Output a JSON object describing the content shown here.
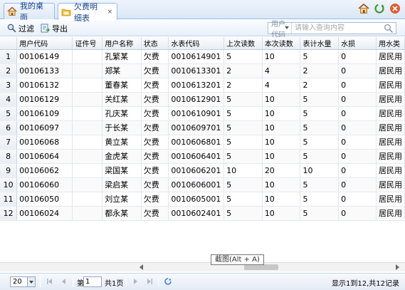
{
  "tabs": [
    {
      "label": "我的桌面",
      "icon": "home-icon",
      "active": false,
      "closable": false
    },
    {
      "label": "欠费明细表",
      "icon": "folder-icon",
      "active": true,
      "closable": true
    }
  ],
  "tab_close_glyph": "×",
  "toolbar": {
    "filter_label": "过滤",
    "export_label": "导出",
    "search_field": "用户代码",
    "search_placeholder": "请输入查询内容"
  },
  "grid": {
    "columns": [
      "",
      "用户代码",
      "证件号",
      "用户名称",
      "状态",
      "水表代码",
      "上次读数",
      "本次读数",
      "表计水量",
      "水损",
      "用水类"
    ],
    "rows": [
      [
        "1",
        "00106149",
        "",
        "孔繁某",
        "欠费",
        "0010614901",
        "5",
        "10",
        "5",
        "0",
        "居民用"
      ],
      [
        "2",
        "00106133",
        "",
        "郑某",
        "欠费",
        "0010613301",
        "2",
        "4",
        "2",
        "0",
        "居民用"
      ],
      [
        "3",
        "00106132",
        "",
        "董春某",
        "欠费",
        "0010613201",
        "2",
        "4",
        "2",
        "0",
        "居民用"
      ],
      [
        "4",
        "00106129",
        "",
        "关红某",
        "欠费",
        "0010612901",
        "5",
        "10",
        "5",
        "0",
        "居民用"
      ],
      [
        "5",
        "00106109",
        "",
        "孔庆某",
        "欠费",
        "0010610901",
        "5",
        "10",
        "5",
        "0",
        "居民用"
      ],
      [
        "6",
        "00106097",
        "",
        "于长某",
        "欠费",
        "0010609701",
        "5",
        "10",
        "5",
        "0",
        "居民用"
      ],
      [
        "7",
        "00106068",
        "",
        "黄立某",
        "欠费",
        "0010606801",
        "5",
        "10",
        "5",
        "0",
        "居民用"
      ],
      [
        "8",
        "00106064",
        "",
        "金虎某",
        "欠费",
        "0010606401",
        "5",
        "10",
        "5",
        "0",
        "居民用"
      ],
      [
        "9",
        "00106062",
        "",
        "梁国某",
        "欠费",
        "0010606201",
        "10",
        "20",
        "10",
        "0",
        "居民用"
      ],
      [
        "10",
        "00106060",
        "",
        "梁启某",
        "欠费",
        "0010606001",
        "5",
        "10",
        "5",
        "0",
        "居民用"
      ],
      [
        "11",
        "00106050",
        "",
        "刘立某",
        "欠费",
        "0010605001",
        "5",
        "10",
        "5",
        "0",
        "居民用"
      ],
      [
        "12",
        "00106024",
        "",
        "都永某",
        "欠费",
        "0010602401",
        "5",
        "10",
        "5",
        "0",
        "居民用"
      ]
    ]
  },
  "tooltip": "截图(Alt + A)",
  "pager": {
    "page_size": "20",
    "page_prefix": "第",
    "page_value": "1",
    "page_total": "共1页",
    "info": "显示1到12,共12记录"
  },
  "colors": {
    "tab_text": "#15428b",
    "border": "#99bbe8"
  }
}
